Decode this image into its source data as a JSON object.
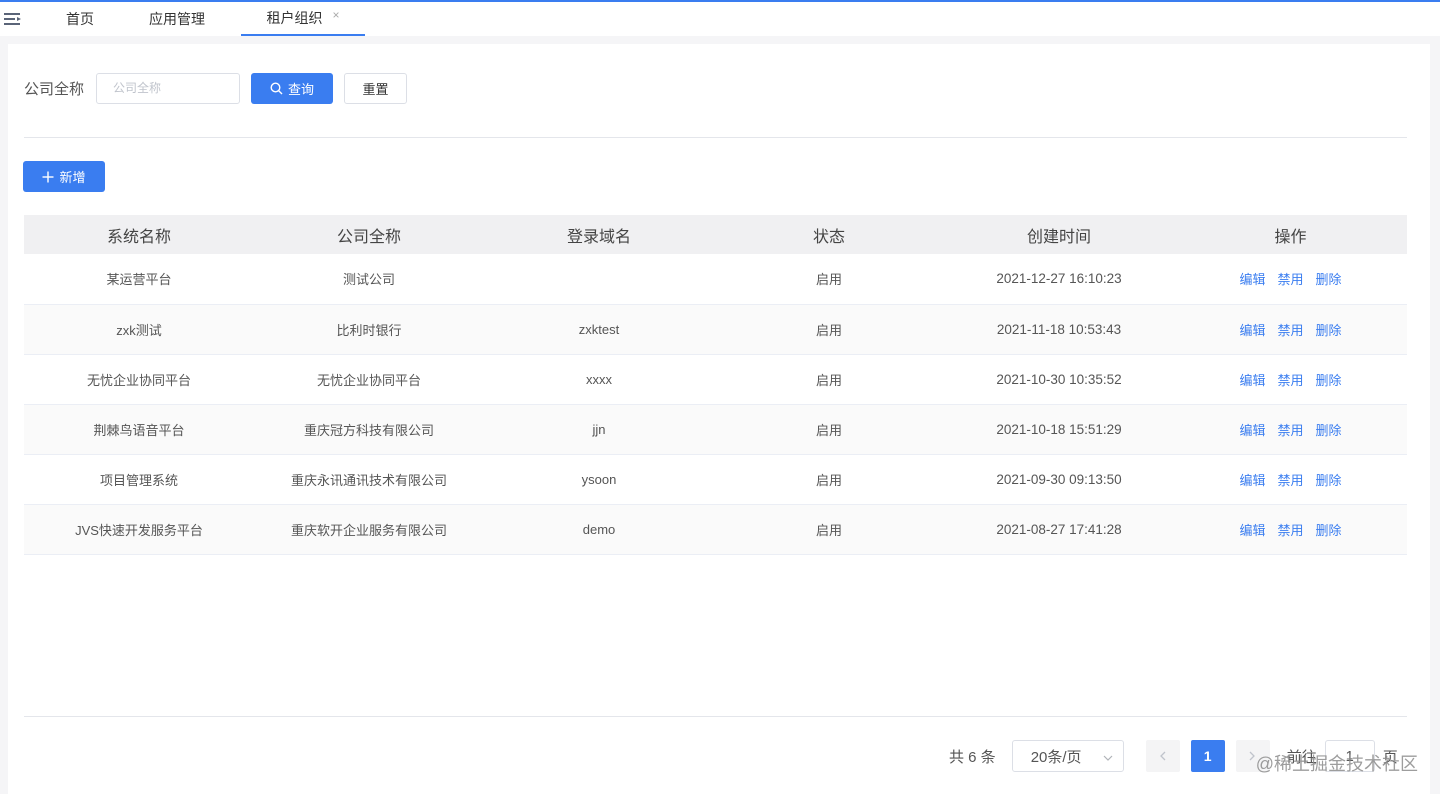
{
  "tabs": [
    {
      "label": "首页"
    },
    {
      "label": "应用管理"
    },
    {
      "label": "租户组织",
      "close": "×",
      "active": true
    }
  ],
  "search": {
    "label": "公司全称",
    "placeholder": "公司全称",
    "value": "",
    "query_label": "查询",
    "reset_label": "重置"
  },
  "toolbar": {
    "add_label": "新增"
  },
  "table": {
    "columns": [
      "系统名称",
      "公司全称",
      "登录域名",
      "状态",
      "创建时间",
      "操作"
    ],
    "rows": [
      {
        "system": "某运营平台",
        "company": "测试公司",
        "domain": "",
        "status": "启用",
        "created": "2021-12-27 16:10:23"
      },
      {
        "system": "zxk测试",
        "company": "比利时银行",
        "domain": "zxktest",
        "status": "启用",
        "created": "2021-11-18 10:53:43"
      },
      {
        "system": "无忧企业协同平台",
        "company": "无忧企业协同平台",
        "domain": "xxxx",
        "status": "启用",
        "created": "2021-10-30 10:35:52"
      },
      {
        "system": "荆棘鸟语音平台",
        "company": "重庆冠方科技有限公司",
        "domain": "jjn",
        "status": "启用",
        "created": "2021-10-18 15:51:29"
      },
      {
        "system": "项目管理系统",
        "company": "重庆永讯通讯技术有限公司",
        "domain": "ysoon",
        "status": "启用",
        "created": "2021-09-30 09:13:50"
      },
      {
        "system": "JVS快速开发服务平台",
        "company": "重庆软开企业服务有限公司",
        "domain": "demo",
        "status": "启用",
        "created": "2021-08-27 17:41:28"
      }
    ],
    "actions": {
      "edit": "编辑",
      "disable": "禁用",
      "delete": "删除"
    }
  },
  "pagination": {
    "total_text": "共 6 条",
    "page_size": "20条/页",
    "current_page": "1",
    "goto_label": "前往",
    "goto_value": "1",
    "page_unit": "页"
  },
  "watermark": "@稀土掘金技术社区",
  "colors": {
    "accent": "#3a7df0",
    "header_bg": "#f0f0f2",
    "page_bg": "#f5f5f7"
  }
}
